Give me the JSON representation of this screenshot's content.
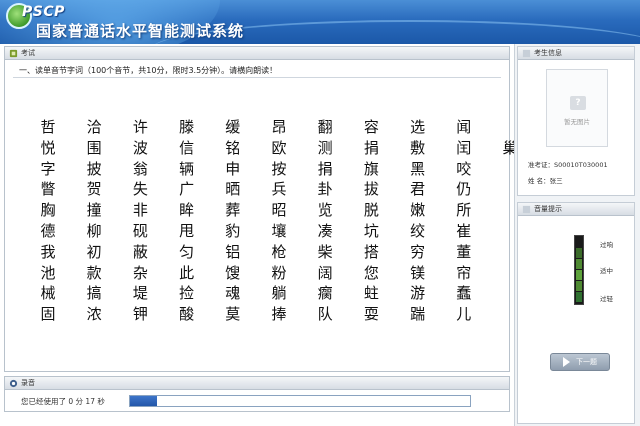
{
  "header": {
    "logo": "PSCP",
    "app_title": "国家普通话水平智能测试系统"
  },
  "exam": {
    "tab_label": "考试",
    "question": "一、读单音节字词（100个音节，共10分，限时3.5分钟）。请横向朗读！",
    "rows": [
      [
        "哲",
        "洽",
        "许",
        "滕",
        "缓",
        "昂",
        "翻",
        "容",
        "选",
        "闻"
      ],
      [
        "悦",
        "围",
        "波",
        "信",
        "铭",
        "欧",
        "测",
        "捐",
        "敷",
        "闰",
        "巢"
      ],
      [
        "字",
        "披",
        "翁",
        "辆",
        "申",
        "按",
        "捐",
        "旗",
        "黑",
        "咬"
      ],
      [
        "瞥",
        "贺",
        "失",
        "广",
        "晒",
        "兵",
        "卦",
        "拔",
        "君",
        "仍"
      ],
      [
        "胸",
        "撞",
        "非",
        "眸",
        "葬",
        "昭",
        "览",
        "脱",
        "嫩",
        "所"
      ],
      [
        "德",
        "柳",
        "砚",
        "甩",
        "豹",
        "壤",
        "凑",
        "坑",
        "绞",
        "崔"
      ],
      [
        "我",
        "初",
        "蔽",
        "匀",
        "铝",
        "枪",
        "柴",
        "搭",
        "穷",
        "董"
      ],
      [
        "池",
        "款",
        "杂",
        "此",
        "馊",
        "粉",
        "阔",
        "您",
        "镁",
        "帘"
      ],
      [
        "械",
        "搞",
        "堤",
        "捡",
        "魂",
        "躺",
        "瘸",
        "蛀",
        "游",
        "蠢"
      ],
      [
        "固",
        "浓",
        "钾",
        "酸",
        "莫",
        "捧",
        "队",
        "耍",
        "踹",
        "儿"
      ]
    ]
  },
  "recording": {
    "tab_label": "录音",
    "elapsed_text": "您已经使用了 0  分 17 秒",
    "progress": 0.08
  },
  "sidebar": {
    "info_label": "考生信息",
    "photo_placeholder": "暂无图片",
    "ticket_line": "准考证：S00010T030001",
    "name_line": "姓    名：张三",
    "volume_label": "音量提示",
    "volume_levels": [
      "过响",
      "适中",
      "过轻"
    ],
    "next_button": "下一题"
  },
  "colors": {
    "header_top": "#4b8fd6",
    "header_bottom": "#1b58a8",
    "progress": "#2f63b8",
    "meter_low": "#2f8f3a",
    "meter_mid": "#6db34a",
    "meter_high": "#c24b2b"
  }
}
